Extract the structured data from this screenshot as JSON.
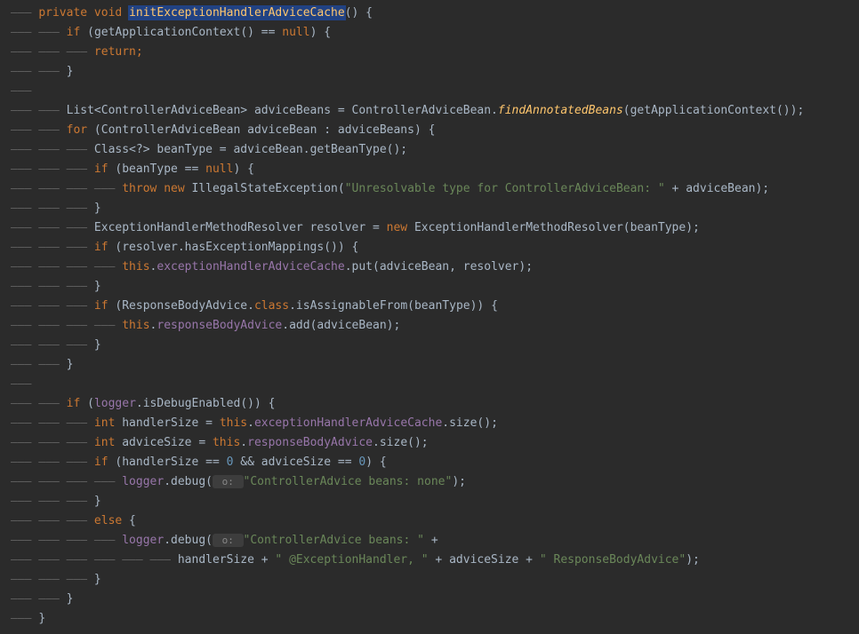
{
  "code": {
    "l1": {
      "kw1": "private void ",
      "method": "initExceptionHandlerAdviceCache",
      "rest": "() {"
    },
    "l2": {
      "kw": "if",
      "rest1": " (",
      "call": "getApplicationContext",
      "rest2": "() == ",
      "kw2": "null",
      "rest3": ") {"
    },
    "l3": {
      "kw": "return",
      "semi": ";"
    },
    "l4": "}",
    "l6": {
      "t1": "List<ControllerAdviceBean> adviceBeans = ControllerAdviceBean.",
      "m": "findAnnotatedBeans",
      "t2": "(",
      "m2": "getApplicationContext",
      "t3": "());"
    },
    "l7": {
      "kw": "for",
      "rest": " (ControllerAdviceBean adviceBean : adviceBeans) {"
    },
    "l8": {
      "t1": "Class<?> beanType = adviceBean.",
      "m": "getBeanType",
      "t2": "();"
    },
    "l9": {
      "kw": "if",
      "t1": " (beanType == ",
      "kw2": "null",
      "t2": ") {"
    },
    "l10": {
      "kw": "throw new",
      "t1": " IllegalStateException(",
      "str": "\"Unresolvable type for ControllerAdviceBean: \"",
      "t2": " + adviceBean);"
    },
    "l11": "}",
    "l12": {
      "t1": "ExceptionHandlerMethodResolver resolver = ",
      "kw": "new",
      "t2": " ExceptionHandlerMethodResolver(beanType);"
    },
    "l13": {
      "kw": "if",
      "t1": " (resolver.",
      "m": "hasExceptionMappings",
      "t2": "()) {"
    },
    "l14": {
      "kw": "this",
      "t1": ".",
      "f": "exceptionHandlerAdviceCache",
      "t2": ".",
      "m": "put",
      "t3": "(adviceBean, resolver);"
    },
    "l15": "}",
    "l16": {
      "kw": "if",
      "t1": " (ResponseBodyAdvice.",
      "kw2": "class",
      "t2": ".",
      "m": "isAssignableFrom",
      "t3": "(beanType)) {"
    },
    "l17": {
      "kw": "this",
      "t1": ".",
      "f": "responseBodyAdvice",
      "t2": ".",
      "m": "add",
      "t3": "(adviceBean);"
    },
    "l18": "}",
    "l19": "}",
    "l21": {
      "kw": "if",
      "t1": " (",
      "f": "logger",
      "t2": ".",
      "m": "isDebugEnabled",
      "t3": "()) {"
    },
    "l22": {
      "kw": "int",
      "t1": " handlerSize = ",
      "kw2": "this",
      "t2": ".",
      "f": "exceptionHandlerAdviceCache",
      "t3": ".",
      "m": "size",
      "t4": "();"
    },
    "l23": {
      "kw": "int",
      "t1": " adviceSize = ",
      "kw2": "this",
      "t2": ".",
      "f": "responseBodyAdvice",
      "t3": ".",
      "m": "size",
      "t4": "();"
    },
    "l24": {
      "kw": "if",
      "t1": " (handlerSize == ",
      "n1": "0",
      "t2": " && adviceSize == ",
      "n2": "0",
      "t3": ") {"
    },
    "l25": {
      "f": "logger",
      "t1": ".",
      "m": "debug",
      "t2": "(",
      "hint": " o: ",
      "str": "\"ControllerAdvice beans: none\"",
      "t3": ");"
    },
    "l26": "}",
    "l27": {
      "kw": "else",
      "t": " {"
    },
    "l28": {
      "f": "logger",
      "t1": ".",
      "m": "debug",
      "t2": "(",
      "hint": " o: ",
      "str": "\"ControllerAdvice beans: \"",
      "t3": " +"
    },
    "l29": {
      "t1": "handlerSize + ",
      "s1": "\" @ExceptionHandler, \"",
      "t2": " + adviceSize + ",
      "s2": "\" ResponseBodyAdvice\"",
      "t3": ");"
    },
    "l30": "}",
    "l31": "}",
    "l32": "}"
  },
  "guides": {
    "g1": "——— ",
    "g2": "——— ——— ",
    "g3": "——— ——— ——— ",
    "g4": "——— ——— ——— ——— ",
    "g5": "——— ——— ——— ——— ——— ",
    "g5d": "——— ——— ——— ——— ——— ——— "
  }
}
